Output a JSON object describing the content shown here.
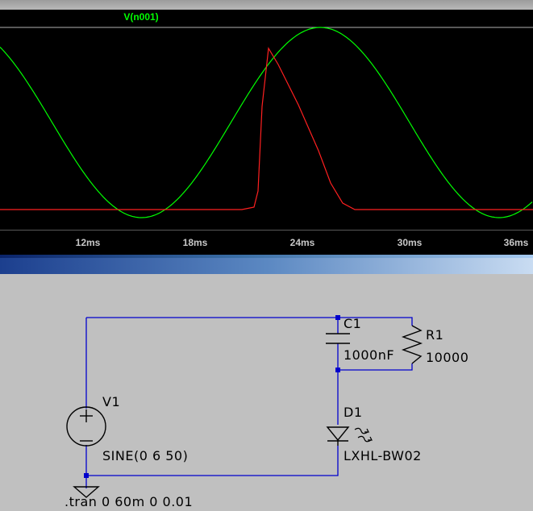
{
  "waveform": {
    "trace_label": "V(n001)",
    "trace_color": "#00ff00",
    "current_trace_color": "#ff2020",
    "background": "#000000",
    "x_ticks": [
      {
        "label": "12ms",
        "t": 12
      },
      {
        "label": "18ms",
        "t": 18
      },
      {
        "label": "24ms",
        "t": 24
      },
      {
        "label": "30ms",
        "t": 30
      },
      {
        "label": "36ms",
        "t": 36
      }
    ]
  },
  "schematic": {
    "capacitor": {
      "name": "C1",
      "value": "1000nF"
    },
    "resistor": {
      "name": "R1",
      "value": "10000"
    },
    "source": {
      "name": "V1",
      "value": "SINE(0 6 50)"
    },
    "diode": {
      "name": "D1",
      "value": "LXHL-BW02"
    },
    "directive": ".tran 0 60m 0 0.01",
    "wire_color": "#0000cc"
  }
}
